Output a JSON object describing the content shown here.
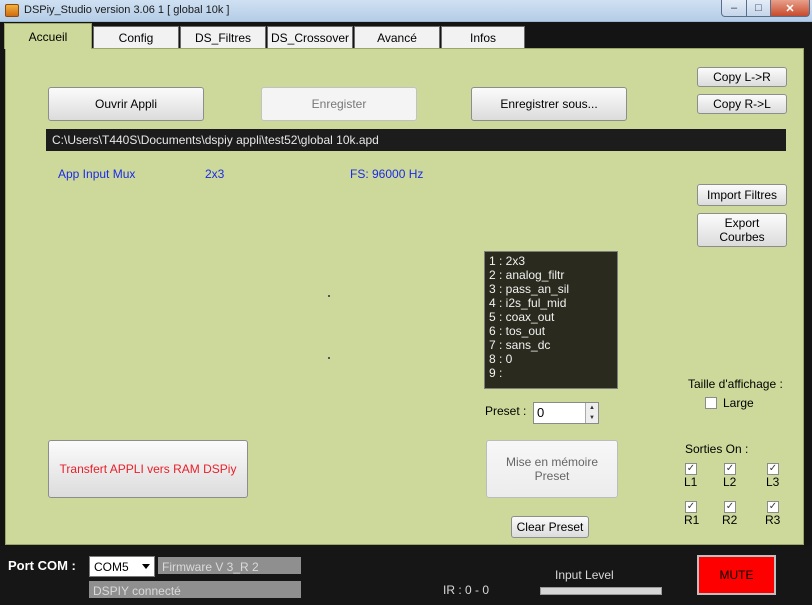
{
  "window": {
    "title": "DSPiy_Studio version 3.06 1 [ global 10k ]",
    "controls": {
      "minimize": "–",
      "maximize": "□",
      "close": "✕"
    }
  },
  "tabs": [
    "Accueil",
    "Config",
    "DS_Filtres",
    "DS_Crossover",
    "Avancé",
    "Infos"
  ],
  "toolbar": {
    "open": "Ouvrir Appli",
    "save": "Enregister",
    "save_as": "Enregistrer sous...",
    "copy_lr": "Copy L->R",
    "copy_rl": "Copy R->L"
  },
  "file_path": "C:\\Users\\T440S\\Documents\\dspiy appli\\test52\\global 10k.apd",
  "info": {
    "mux_label": "App Input Mux",
    "mux_value": "2x3",
    "fs": "FS: 96000 Hz"
  },
  "side_buttons": {
    "import": "Import Filtres",
    "export_line1": "Export",
    "export_line2": "Courbes"
  },
  "presets": [
    "1 : 2x3",
    "2 : analog_filtr",
    "3 : pass_an_sil",
    "4 : i2s_ful_mid",
    "5 : coax_out",
    "6 : tos_out",
    "7 : sans_dc",
    "8 : 0",
    "9 :"
  ],
  "preset": {
    "label": "Preset :",
    "value": "0"
  },
  "display": {
    "label": "Taille d'affichage :",
    "large": "Large",
    "large_checked": false
  },
  "transfer_button": "Transfert APPLI vers RAM DSPiy",
  "transfer_color": "#e8202a",
  "save_preset": {
    "line1": "Mise en mémoire",
    "line2": "Preset"
  },
  "clear_preset": "Clear Preset",
  "outputs": {
    "label": "Sorties On :",
    "items": [
      {
        "name": "L1",
        "checked": true
      },
      {
        "name": "L2",
        "checked": true
      },
      {
        "name": "L3",
        "checked": true
      },
      {
        "name": "R1",
        "checked": true
      },
      {
        "name": "R2",
        "checked": true
      },
      {
        "name": "R3",
        "checked": true
      }
    ]
  },
  "status": {
    "port_label": "Port COM :",
    "port_value": "COM5",
    "firmware": "Firmware V 3_R 2",
    "connection": "DSPIY connecté",
    "ir": "IR : 0 - 0",
    "input_level_label": "Input Level",
    "input_level_fraction": 0,
    "mute": "MUTE"
  },
  "colors": {
    "panel": "#cdd99a",
    "mute": "#ff0000",
    "info_text": "#1a2be8"
  }
}
